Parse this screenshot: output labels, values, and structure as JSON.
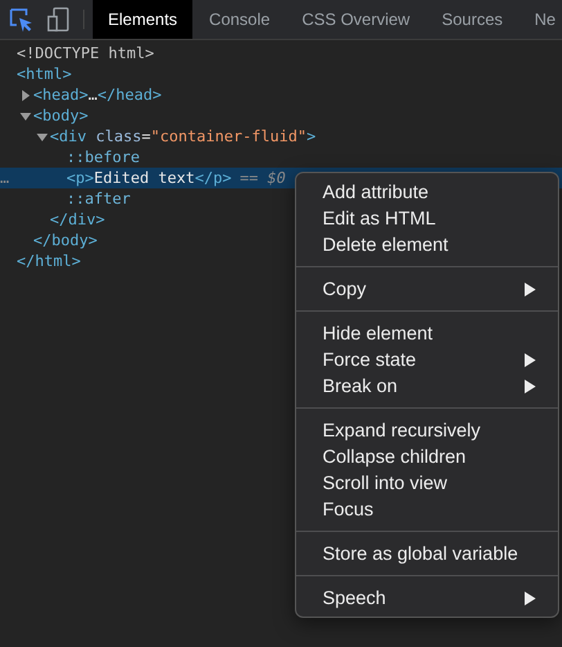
{
  "toolbar": {
    "tabs": [
      {
        "label": "Elements",
        "selected": true
      },
      {
        "label": "Console",
        "selected": false
      },
      {
        "label": "CSS Overview",
        "selected": false
      },
      {
        "label": "Sources",
        "selected": false
      },
      {
        "label": "Ne",
        "selected": false
      }
    ],
    "inspect_active": true
  },
  "dom_tree": [
    {
      "kind": "doctype",
      "selected": false,
      "tokens": [
        {
          "text": "<!DOCTYPE html>"
        }
      ]
    },
    {
      "kind": "root",
      "selected": false,
      "tokens": [
        {
          "text": "<html>"
        }
      ],
      "children": [
        {
          "kind": "element",
          "expanded": false,
          "selected": false,
          "tokens": [
            {
              "kind": "tag",
              "text": "<head>"
            },
            {
              "kind": "text",
              "text": "…"
            },
            {
              "kind": "tag",
              "text": "</head>"
            }
          ]
        },
        {
          "kind": "element",
          "expanded": true,
          "selected": false,
          "tokens": [
            {
              "kind": "tag",
              "text": "<body>"
            }
          ],
          "children": [
            {
              "kind": "element",
              "expanded": true,
              "selected": false,
              "tokens": [
                {
                  "kind": "tag",
                  "text": "<div"
                },
                {
                  "kind": "attr",
                  "text": " class"
                },
                {
                  "kind": "text",
                  "text": "="
                },
                {
                  "kind": "value",
                  "text": "\"container-fluid\""
                },
                {
                  "kind": "tag",
                  "text": ">"
                }
              ],
              "children": [
                {
                  "kind": "pseudo",
                  "selected": false,
                  "tokens": [
                    {
                      "text": "::before"
                    }
                  ]
                },
                {
                  "kind": "leaf",
                  "selected": true,
                  "tokens": [
                    {
                      "kind": "tag",
                      "text": "<p>"
                    },
                    {
                      "text": "Edited text"
                    },
                    {
                      "kind": "tag",
                      "text": "</p>"
                    }
                  ],
                  "marker": "== $0",
                  "gutter": "…"
                },
                {
                  "kind": "pseudo",
                  "selected": false,
                  "tokens": [
                    {
                      "text": "::after"
                    }
                  ]
                }
              ],
              "close": [
                {
                  "text": "</div>"
                }
              ]
            }
          ],
          "close": [
            {
              "text": "</body>"
            }
          ]
        }
      ],
      "close": [
        {
          "text": "</html>"
        }
      ]
    }
  ],
  "context_menu": {
    "groups": [
      {
        "items": [
          {
            "label": "Add attribute",
            "has_submenu": false
          },
          {
            "label": "Edit as HTML",
            "has_submenu": false
          },
          {
            "label": "Delete element",
            "has_submenu": false
          }
        ]
      },
      {
        "items": [
          {
            "label": "Copy",
            "has_submenu": true
          }
        ]
      },
      {
        "items": [
          {
            "label": "Hide element",
            "has_submenu": false
          },
          {
            "label": "Force state",
            "has_submenu": true
          },
          {
            "label": "Break on",
            "has_submenu": true
          }
        ]
      },
      {
        "items": [
          {
            "label": "Expand recursively",
            "has_submenu": false
          },
          {
            "label": "Collapse children",
            "has_submenu": false
          },
          {
            "label": "Scroll into view",
            "has_submenu": false
          },
          {
            "label": "Focus",
            "has_submenu": false
          }
        ]
      },
      {
        "items": [
          {
            "label": "Store as global variable",
            "has_submenu": false
          }
        ]
      },
      {
        "items": [
          {
            "label": "Speech",
            "has_submenu": true
          }
        ]
      }
    ]
  }
}
